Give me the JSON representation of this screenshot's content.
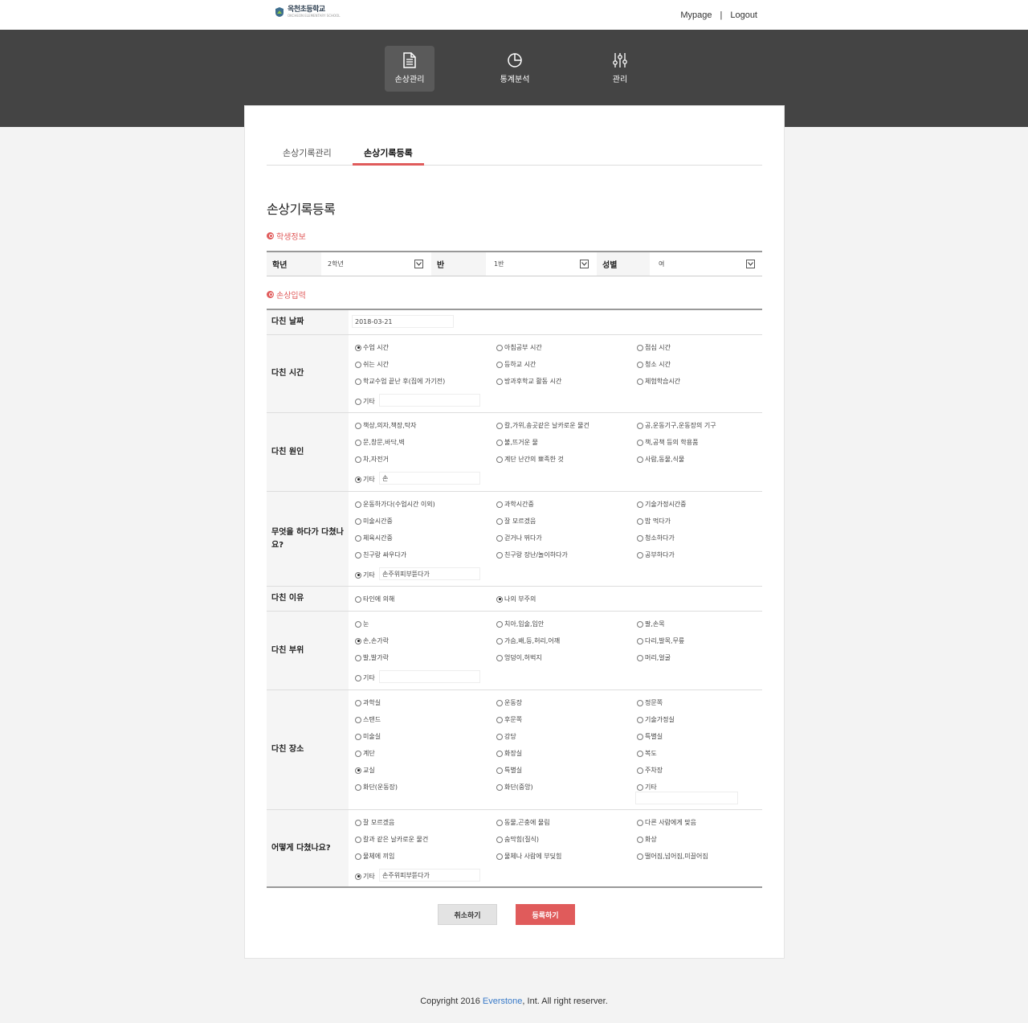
{
  "header": {
    "logo_text": "옥천초등학교",
    "logo_sub": "OKCHEON ELEMENTARY SCHOOL",
    "links": {
      "mypage": "Mypage",
      "sep": "|",
      "logout": "Logout"
    }
  },
  "nav": [
    {
      "label": "손상관리",
      "icon": "document-icon",
      "active": true
    },
    {
      "label": "통계분석",
      "icon": "pie-chart-icon",
      "active": false
    },
    {
      "label": "관리",
      "icon": "sliders-icon",
      "active": false
    }
  ],
  "tabs": {
    "list": "손상기록관리",
    "register": "손상기록등록"
  },
  "page_title": "손상기록등록",
  "sections": {
    "student": "학생정보",
    "injury": "손상입력"
  },
  "student": {
    "grade_label": "학년",
    "grade_value": "2학년",
    "class_label": "반",
    "class_value": "1반",
    "gender_label": "성별",
    "gender_value": "여"
  },
  "form": {
    "date": {
      "label": "다친 날짜",
      "value": "2018-03-21"
    },
    "time": {
      "label": "다친 시간",
      "options": [
        "수업 시간",
        "아침공부 시간",
        "점심 시간",
        "쉬는 시간",
        "등하교 시간",
        "청소 시간",
        "학교수업 끝난 후(집에 가기전)",
        "방과후학교 활동 시간",
        "체험학습시간"
      ],
      "other": "기타",
      "other_value": ""
    },
    "cause": {
      "label": "다친 원인",
      "options": [
        "책상,의자,책장,탁자",
        "칼,가위,송곳같은 날카로운 물건",
        "공,운동기구,운동장의 기구",
        "문,창문,바닥,벽",
        "불,뜨거운 물",
        "책,공책 등의 학용품",
        "차,자전거",
        "계단 난간의 뾰족한 것",
        "사람,동물,식물"
      ],
      "other": "기타",
      "other_value": "손"
    },
    "activity": {
      "label": "무엇을 하다가 다쳤나요?",
      "options": [
        "운동하가다(수업시간 이외)",
        "과학시간중",
        "기술가정시간중",
        "미술시간중",
        "잘 모르겠음",
        "밥 먹다가",
        "체육시간중",
        "걷거나 뛰다가",
        "청소하다가",
        "친구랑 싸우다가",
        "친구랑 장난/놀이하다가",
        "공부하다가"
      ],
      "other": "기타",
      "other_value": "손주위피부뜯다가"
    },
    "reason": {
      "label": "다친 이유",
      "options": [
        "타인에 의해",
        "나의 부주의"
      ]
    },
    "body": {
      "label": "다친 부위",
      "options": [
        "눈",
        "치아,입술,입안",
        "팔,손목",
        "손,손가락",
        "가슴,배,등,허리,어깨",
        "다리,발목,무릎",
        "발,발가락",
        "엉덩이,허벅지",
        "머리,얼굴"
      ],
      "other": "기타",
      "other_value": ""
    },
    "place": {
      "label": "다친 장소",
      "options": [
        "과학실",
        "운동장",
        "정문쪽",
        "스탠드",
        "후문쪽",
        "기술가정실",
        "미술실",
        "강당",
        "특별실",
        "계단",
        "화장실",
        "복도",
        "교실",
        "특별실",
        "주차장",
        "화단(운동장)",
        "화단(중앙)",
        "기타"
      ],
      "other_value": ""
    },
    "how": {
      "label": "어떻게 다쳤나요?",
      "options": [
        "잘 모르겠음",
        "동물,곤충에 물림",
        "다른 사람에게 맞음",
        "칼과 같은 날카로운 물건",
        "숨막힘(질식)",
        "화상",
        "물체에 끼임",
        "물체나 사람에 부딪힘",
        "떨어짐,넘어짐,미끌어짐"
      ],
      "other": "기타",
      "other_value": "손주위피부뜯다가"
    }
  },
  "buttons": {
    "cancel": "취소하기",
    "submit": "등록하기"
  },
  "footer": {
    "pre": "Copyright 2016 ",
    "brand": "Everstone",
    "post": ", Int. All right reserver."
  },
  "colors": {
    "accent": "#e05b5b",
    "nav_bg": "#444444"
  }
}
